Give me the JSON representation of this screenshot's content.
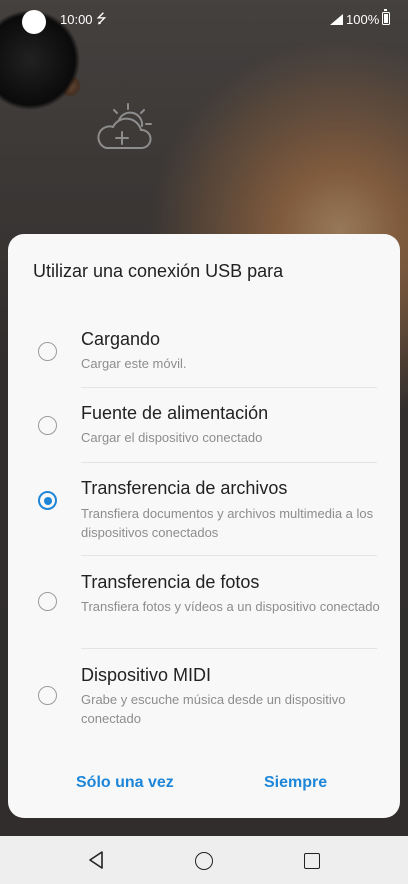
{
  "status_bar": {
    "time": "10:00",
    "battery": "100%"
  },
  "dialog": {
    "title": "Utilizar una conexión USB para",
    "options": [
      {
        "title": "Cargando",
        "subtitle": "Cargar este móvil.",
        "selected": false
      },
      {
        "title": "Fuente de alimentación",
        "subtitle": "Cargar el dispositivo conectado",
        "selected": false
      },
      {
        "title": "Transferencia de archivos",
        "subtitle": "Transfiera documentos y archivos multimedia a los dispositivos conectados",
        "selected": true
      },
      {
        "title": "Transferencia de fotos",
        "subtitle": "Transfiera fotos y vídeos a un dispositivo conectado",
        "selected": false
      },
      {
        "title": "Dispositivo MIDI",
        "subtitle": "Grabe y escuche música desde un dispositivo conectado",
        "selected": false
      }
    ],
    "buttons": {
      "once": "Sólo una vez",
      "always": "Siempre"
    }
  },
  "colors": {
    "accent": "#1d86d9",
    "dialog_bg": "#f8f8f8",
    "subtitle": "#8d8d8d"
  },
  "icons": {
    "usb": "usb-icon",
    "signal": "signal-icon",
    "battery": "battery-icon",
    "weather": "weather-icon",
    "back": "back-icon",
    "home": "home-icon",
    "recents": "recents-icon"
  }
}
